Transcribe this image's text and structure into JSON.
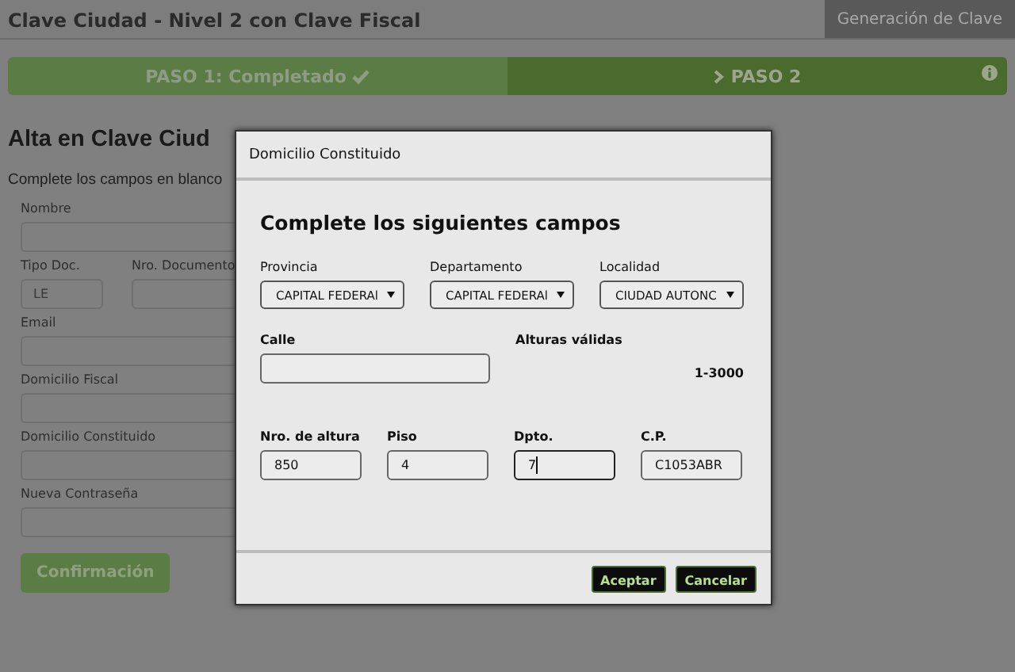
{
  "header": {
    "title": "Clave Ciudad - Nivel 2 con Clave Fiscal",
    "tab": "Generación de Clave"
  },
  "steps": [
    {
      "label": "PASO 1: Completado",
      "done": true,
      "current": false
    },
    {
      "label": "PASO 2",
      "done": false,
      "current": true
    }
  ],
  "page": {
    "heading": "Alta en Clave Ciud",
    "intro": "Complete los campos en blanco",
    "fields": [
      {
        "label": "Nombre"
      },
      {
        "label": "Tipo Doc.",
        "value": "LE"
      },
      {
        "label": "Nro. Documento"
      },
      {
        "label": "Email"
      },
      {
        "label": "Domicilio Fiscal"
      },
      {
        "label": "Domicilio Constituido"
      },
      {
        "label": "Nueva Contraseña"
      }
    ],
    "submit": "Confirmación"
  },
  "dialog": {
    "title": "Domicilio Constituido",
    "heading": "Complete los siguientes campos",
    "selects": [
      {
        "label": "Provincia",
        "value": "CAPITAL FEDERAl"
      },
      {
        "label": "Departamento",
        "value": "CAPITAL FEDERAl"
      },
      {
        "label": "Localidad",
        "value": "CIUDAD AUTONC"
      }
    ],
    "street": {
      "label": "Calle"
    },
    "heights": {
      "label": "Alturas válidas",
      "value": "1-3000"
    },
    "inputs": [
      {
        "label": "Nro. de altura",
        "value": "850",
        "focused": false
      },
      {
        "label": "Piso",
        "value": "4",
        "focused": false
      },
      {
        "label": "Dpto.",
        "value": "7",
        "focused": true
      },
      {
        "label": "C.P.",
        "value": "C1053ABR",
        "focused": false
      }
    ],
    "buttons": [
      "Aceptar",
      "Cancelar"
    ]
  }
}
